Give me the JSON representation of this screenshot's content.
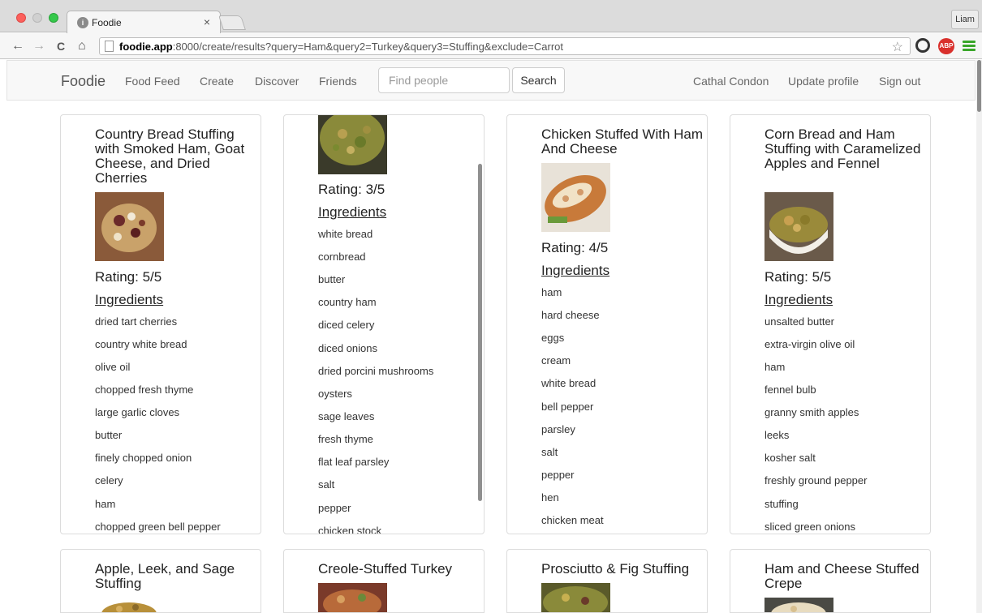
{
  "browser": {
    "tab_title": "Foodie",
    "tab_favicon": "i",
    "tab_close": "×",
    "user": "Liam",
    "url_host": "foodie.app",
    "url_rest": ":8000/create/results?query=Ham&query2=Turkey&query3=Stuffing&exclude=Carrot",
    "back": "←",
    "forward": "→",
    "reload": "C",
    "home": "⌂",
    "star": "☆",
    "abp": "ABP"
  },
  "navbar": {
    "brand": "Foodie",
    "links": [
      "Food Feed",
      "Create",
      "Discover",
      "Friends"
    ],
    "search_placeholder": "Find people",
    "search_button": "Search",
    "user_name": "Cathal Condon",
    "update_profile": "Update profile",
    "sign_out": "Sign out"
  },
  "labels": {
    "ingredients": "Ingredients"
  },
  "recipes": [
    {
      "title": "Country Bread Stuffing with Smoked Ham, Goat Cheese, and Dried Cherries",
      "rating": "Rating: 5/5",
      "ingredients": [
        "dried tart cherries",
        "country white bread",
        "olive oil",
        "chopped fresh thyme",
        "large garlic cloves",
        "butter",
        "finely chopped onion",
        "celery",
        "ham",
        "chopped green bell pepper"
      ]
    },
    {
      "title": "",
      "rating": "Rating: 3/5",
      "ingredients": [
        "white bread",
        "cornbread",
        "butter",
        "country ham",
        "diced celery",
        "diced onions",
        "dried porcini mushrooms",
        "oysters",
        "sage leaves",
        "fresh thyme",
        "flat leaf parsley",
        "salt",
        "pepper",
        "chicken stock"
      ]
    },
    {
      "title": "Chicken Stuffed With Ham And Cheese",
      "rating": "Rating: 4/5",
      "ingredients": [
        "ham",
        "hard cheese",
        "eggs",
        "cream",
        "white bread",
        "bell pepper",
        "parsley",
        "salt",
        "pepper",
        "hen",
        "chicken meat"
      ]
    },
    {
      "title": "Corn Bread and Ham Stuffing with Caramelized Apples and Fennel",
      "rating": "Rating: 5/5",
      "ingredients": [
        "unsalted butter",
        "extra-virgin olive oil",
        "ham",
        "fennel bulb",
        "granny smith apples",
        "leeks",
        "kosher salt",
        "freshly ground pepper",
        "stuffing",
        "sliced green onions"
      ]
    }
  ],
  "recipes_row2": [
    {
      "title": "Apple, Leek, and Sage Stuffing"
    },
    {
      "title": "Creole-Stuffed Turkey"
    },
    {
      "title": "Prosciutto & Fig Stuffing"
    },
    {
      "title": "Ham and Cheese Stuffed Crepe"
    }
  ]
}
